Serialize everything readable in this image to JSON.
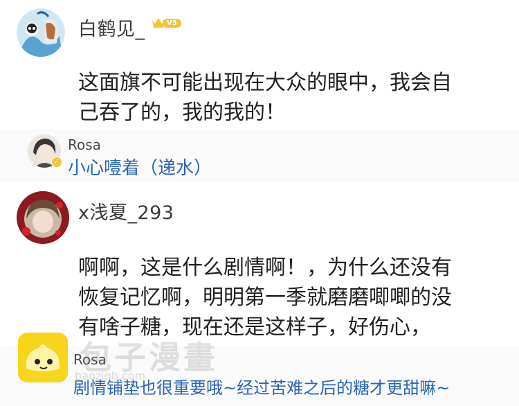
{
  "comments": [
    {
      "username": "白鹤见_",
      "level_badge": "V3",
      "text_lines": [
        "这面旗不可能出现在大众的眼中，我会自",
        "己吞了的，我的我的！"
      ],
      "reply": {
        "username": "Rosa",
        "text": "小心噎着（递水）"
      }
    },
    {
      "username": "x浅夏_293",
      "text_lines": [
        "啊啊，这是什么剧情啊！，为什么还没有",
        "恢复记忆啊，明明第一季就磨磨唧唧的没",
        "有啥子糖，现在还是这样子，好伤心，"
      ],
      "reply": {
        "username": "Rosa",
        "text": "剧情铺垫也很重要哦~经过苦难之后的糖才更甜嘛~"
      }
    }
  ],
  "watermark": {
    "title": "包子漫畫",
    "url": "baoziqh.com"
  },
  "colors": {
    "reply_link": "#2a63b7",
    "badge_gold": "#f3c33a"
  }
}
